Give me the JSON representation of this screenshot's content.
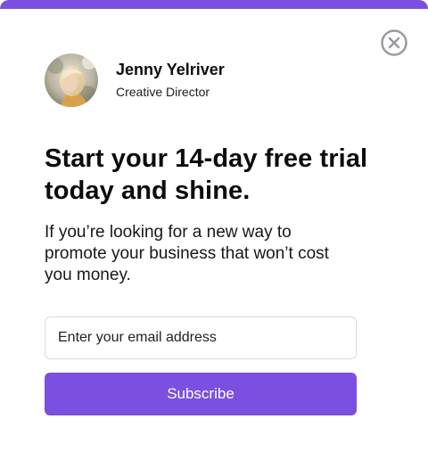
{
  "profile": {
    "name": "Jenny Yelriver",
    "role": "Creative Director"
  },
  "headline": "Start your 14-day free trial today and shine.",
  "description": "If you’re looking for a new way to promote your business that won’t cost you money.",
  "form": {
    "email_placeholder": "Enter your email address",
    "subscribe_label": "Subscribe"
  },
  "colors": {
    "accent": "#7b4fe0",
    "close_icon": "#9a9aa0"
  },
  "icons": {
    "close": "close-circle-icon"
  }
}
